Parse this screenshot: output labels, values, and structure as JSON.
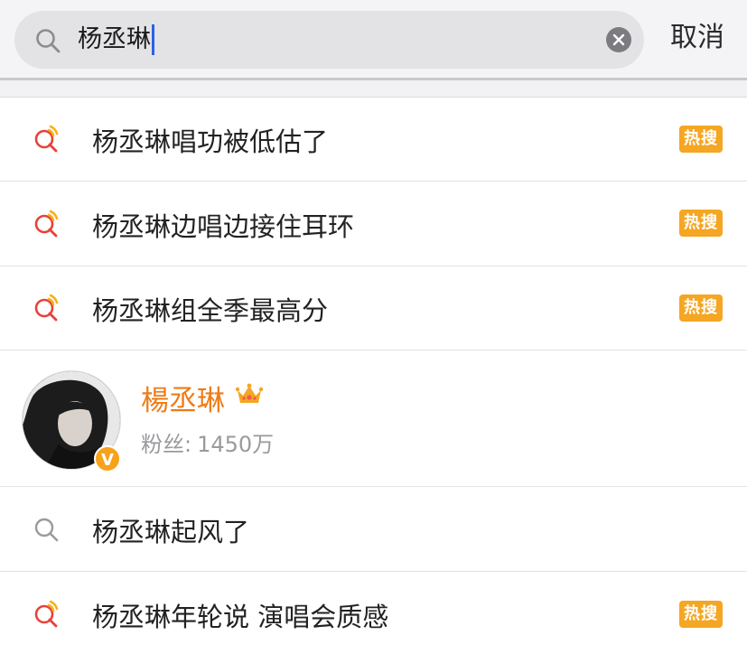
{
  "search": {
    "query": "杨丞琳",
    "cancel_label": "取消"
  },
  "suggestions": [
    {
      "text": "杨丞琳唱功被低估了",
      "badge": "热搜",
      "icon": "hot-search-icon"
    },
    {
      "text": "杨丞琳边唱边接住耳环",
      "badge": "热搜",
      "icon": "hot-search-icon"
    },
    {
      "text": "杨丞琳组全季最高分",
      "badge": "热搜",
      "icon": "hot-search-icon"
    },
    {
      "text": "杨丞琳起风了",
      "badge": "",
      "icon": "search-icon"
    },
    {
      "text": "杨丞琳年轮说 演唱会质感",
      "badge": "热搜",
      "icon": "hot-search-icon"
    }
  ],
  "user_card": {
    "name": "楊丞琳",
    "followers_label": "粉丝:",
    "followers_count": "1450万",
    "verified_mark": "V",
    "crown_icon": "crown-icon"
  },
  "colors": {
    "hot_badge": "#f5a623",
    "user_name": "#ee7b16",
    "caret": "#2b62e6",
    "hot_icon_red": "#e8413a",
    "hot_icon_yellow": "#f5b21d"
  }
}
